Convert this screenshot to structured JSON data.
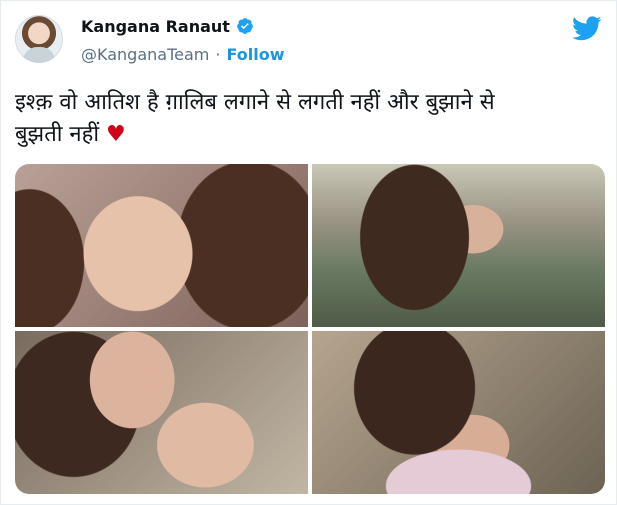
{
  "tweet": {
    "author_name": "Kangana Ranaut",
    "handle": "@KanganaTeam",
    "separator": "·",
    "follow_label": "Follow",
    "text_line1": "इश्क़ वो आतिश है ग़ालिब लगाने से लगती नहीं और बुझाने से",
    "text_line2": "बुझती नहीं",
    "heart": "♥",
    "colors": {
      "link": "#1b95e0",
      "verified": "#1da1f2",
      "heart": "#d0021b",
      "secondary_text": "#5b7083"
    },
    "icons": [
      "twitter-bird-icon",
      "verified-badge-icon"
    ],
    "media_count": 4
  }
}
